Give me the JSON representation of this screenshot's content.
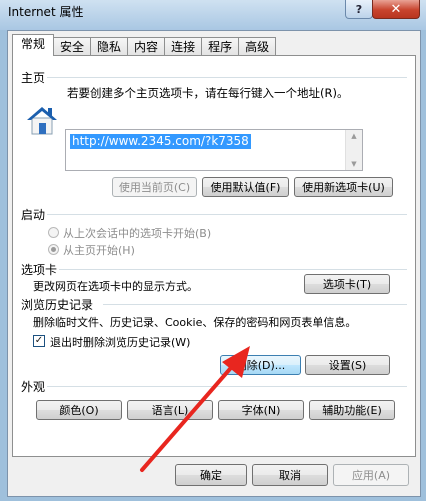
{
  "window": {
    "title": "Internet 属性",
    "help_label": "?",
    "close_label": "✕"
  },
  "tabs": [
    {
      "label": "常规",
      "active": true
    },
    {
      "label": "安全",
      "active": false
    },
    {
      "label": "隐私",
      "active": false
    },
    {
      "label": "内容",
      "active": false
    },
    {
      "label": "连接",
      "active": false
    },
    {
      "label": "程序",
      "active": false
    },
    {
      "label": "高级",
      "active": false
    }
  ],
  "homepage": {
    "section_label": "主页",
    "instruction": "若要创建多个主页选项卡，请在每行键入一个地址(R)。",
    "url_value": "http://www.2345.com/?k7358",
    "buttons": {
      "use_current": "使用当前页(C)",
      "use_default": "使用默认值(F)",
      "use_new_tab": "使用新选项卡(U)"
    }
  },
  "startup": {
    "section_label": "启动",
    "option_last_session": "从上次会话中的选项卡开始(B)",
    "option_homepage": "从主页开始(H)"
  },
  "tabs_section": {
    "section_label": "选项卡",
    "description": "更改网页在选项卡中的显示方式。",
    "button": "选项卡(T)"
  },
  "history": {
    "section_label": "浏览历史记录",
    "description": "删除临时文件、历史记录、Cookie、保存的密码和网页表单信息。",
    "checkbox_label": "退出时删除浏览历史记录(W)",
    "checkbox_checked": true,
    "delete_button": "删除(D)...",
    "settings_button": "设置(S)"
  },
  "appearance": {
    "section_label": "外观",
    "buttons": [
      "颜色(O)",
      "语言(L)",
      "字体(N)",
      "辅助功能(E)"
    ]
  },
  "footer": {
    "ok": "确定",
    "cancel": "取消",
    "apply": "应用(A)"
  },
  "colors": {
    "annotation_arrow": "#e8261f",
    "selection": "#3399ff",
    "house_roof": "#1b5fae"
  },
  "icons": {
    "homepage": "house-icon",
    "annotation": "red-arrow-annotation"
  }
}
